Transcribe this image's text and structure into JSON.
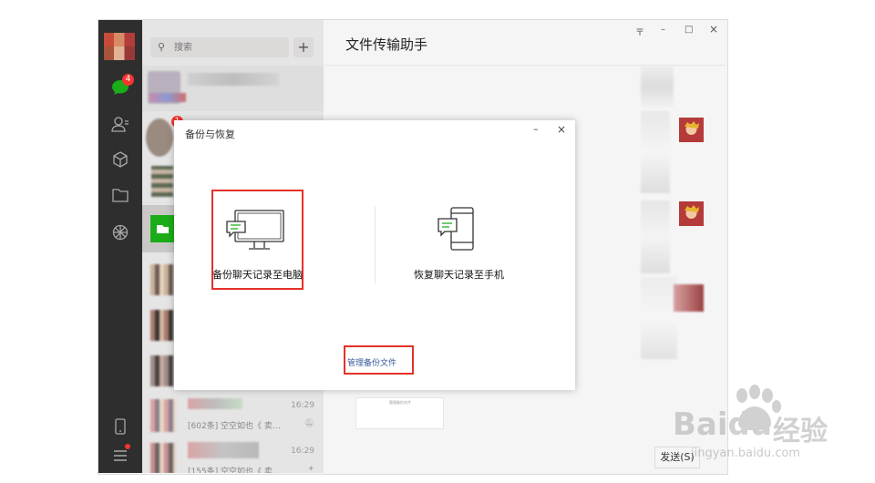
{
  "app": {
    "unread_badge": "4",
    "second_badge": "1"
  },
  "search": {
    "placeholder": "搜索",
    "add": "+"
  },
  "chat_list": {
    "items": [
      {
        "time": "16:29",
        "preview": "[602条] 空空如也《 卖…"
      },
      {
        "time": "16:29",
        "preview": "[155条] 空空如也《 卖…"
      }
    ]
  },
  "main": {
    "title": "文件传输助手",
    "send_label": "发送(S)",
    "file_thumb_text": "管理备份文件"
  },
  "dialog": {
    "title": "备份与恢复",
    "minimize": "–",
    "close": "×",
    "backup_label": "备份聊天记录至电脑",
    "restore_label": "恢复聊天记录至手机",
    "manage_link": "管理备份文件"
  },
  "window_controls": {
    "pin": "〒",
    "minimize": "–",
    "maximize": "□",
    "close": "×"
  },
  "watermark": {
    "brand": "Baidu",
    "brand_cn": "经验",
    "url": "jingyan.baidu.com"
  },
  "colors": {
    "accent_green": "#1aad19",
    "highlight_red": "#e5312c",
    "sidebar": "#2e2e2e"
  }
}
